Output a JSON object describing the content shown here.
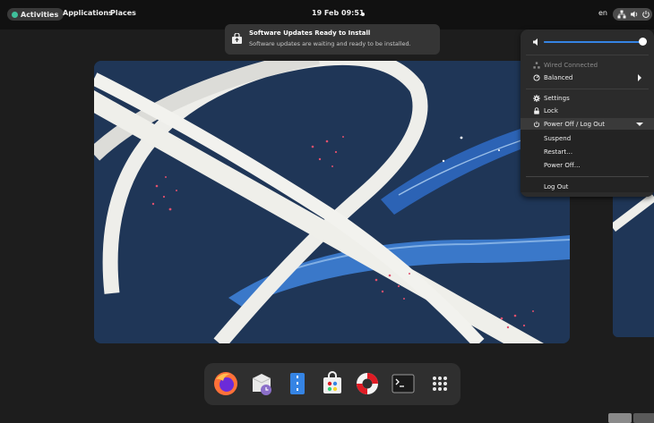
{
  "topbar": {
    "activities": "Activities",
    "applications": "Applications",
    "places": "Places",
    "clock": "19 Feb  09:51",
    "language": "en",
    "tray_icons": [
      "network-icon",
      "volume-icon",
      "power-icon"
    ]
  },
  "notification": {
    "title": "Software Updates Ready to Install",
    "body": "Software updates are waiting and ready to be installed.",
    "icon": "software-update-icon"
  },
  "quick_settings": {
    "volume": {
      "icon": "speaker-icon",
      "level": 1.0
    },
    "network": {
      "label": "Wired Connected",
      "icon": "network-icon"
    },
    "power_mode": {
      "label": "Balanced",
      "icon": "power-profile-icon"
    },
    "settings": {
      "label": "Settings",
      "icon": "gear-icon"
    },
    "lock": {
      "label": "Lock",
      "icon": "lock-icon"
    },
    "power": {
      "label": "Power Off / Log Out",
      "icon": "power-icon",
      "items": [
        "Suspend",
        "Restart…",
        "Power Off…"
      ],
      "logout": "Log Out"
    }
  },
  "dash": {
    "apps": [
      {
        "name": "Firefox",
        "icon": "firefox-icon"
      },
      {
        "name": "Software Update",
        "icon": "update-clock-icon"
      },
      {
        "name": "Files",
        "icon": "files-icon"
      },
      {
        "name": "Software",
        "icon": "software-store-icon"
      },
      {
        "name": "Help",
        "icon": "lifebuoy-icon"
      },
      {
        "name": "Terminal",
        "icon": "terminal-icon"
      },
      {
        "name": "Show Applications",
        "icon": "app-grid-icon"
      }
    ]
  },
  "colors": {
    "accent": "#3584e4",
    "panel": "#111111",
    "menu": "#2b2b2b",
    "wallpaper": "#1f3657"
  }
}
